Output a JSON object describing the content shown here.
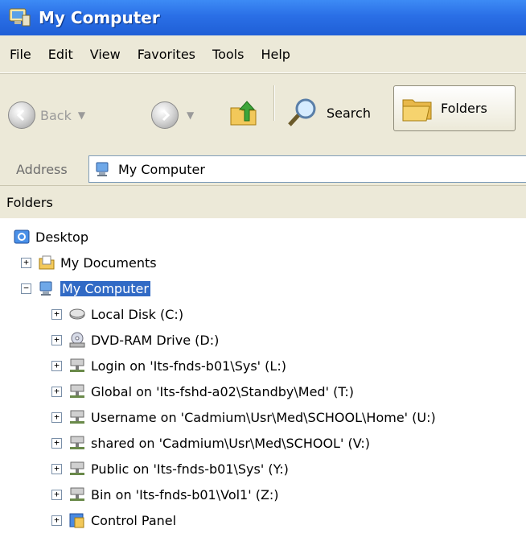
{
  "window": {
    "title": "My Computer"
  },
  "menu": [
    "File",
    "Edit",
    "View",
    "Favorites",
    "Tools",
    "Help"
  ],
  "toolbar": {
    "back": "Back",
    "search": "Search",
    "folders": "Folders"
  },
  "address": {
    "label": "Address",
    "value": "My Computer"
  },
  "pane": {
    "title": "Folders"
  },
  "tree": {
    "desktop": "Desktop",
    "my_documents": "My Documents",
    "my_computer": "My Computer",
    "drives": [
      "Local Disk (C:)",
      "DVD-RAM Drive (D:)",
      "Login on 'Its-fnds-b01\\Sys' (L:)",
      "Global on 'Its-fshd-a02\\Standby\\Med' (T:)",
      "Username on 'Cadmium\\Usr\\Med\\SCHOOL\\Home' (U:)",
      "shared on 'Cadmium\\Usr\\Med\\SCHOOL' (V:)",
      "Public on 'Its-fnds-b01\\Sys' (Y:)",
      "Bin on 'Its-fnds-b01\\Vol1' (Z:)",
      "Control Panel"
    ],
    "expander": {
      "plus": "+",
      "minus": "−"
    }
  }
}
